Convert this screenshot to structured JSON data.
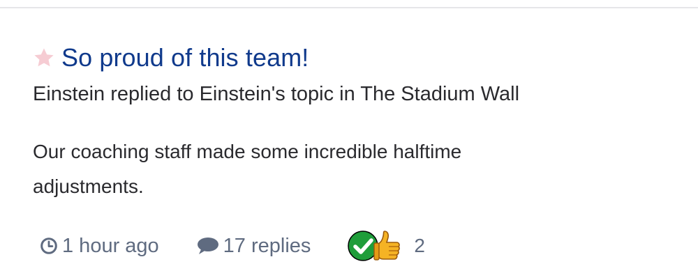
{
  "post": {
    "title": "So proud of this team!",
    "subtitle": "Einstein replied to Einstein's topic in The Stadium Wall",
    "body": "Our coaching staff made some incredible halftime adjustments.",
    "star_icon": "star-icon",
    "star_color": "#f6ccd3",
    "title_color": "#103a8c"
  },
  "meta": {
    "time": "1 hour ago",
    "replies": "17 replies",
    "reaction_count": "2",
    "clock_icon": "clock-icon",
    "comment_icon": "comment-icon",
    "reaction_icons": [
      "check-circle-icon",
      "thumbs-up-icon"
    ],
    "muted_color": "#5f6b80",
    "check_color": "#1f9d3a"
  }
}
